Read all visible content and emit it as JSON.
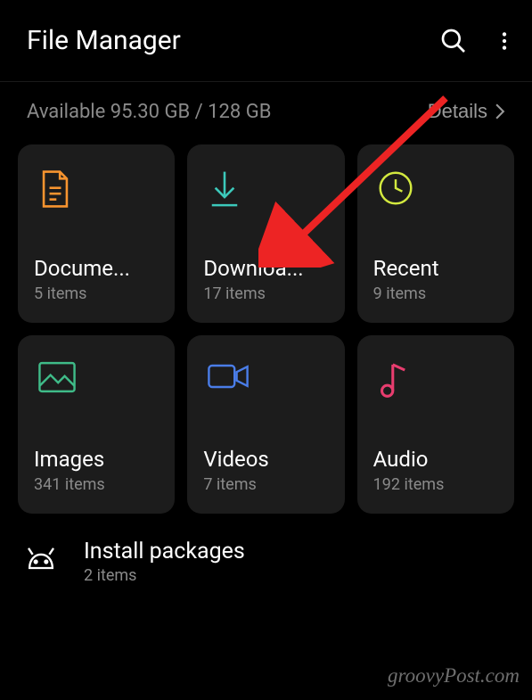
{
  "header": {
    "title": "File Manager"
  },
  "storage": {
    "text": "Available 95.30 GB / 128 GB",
    "details_label": "Details"
  },
  "tiles": [
    {
      "title": "Docume...",
      "sub": "5 items",
      "icon": "document",
      "color": "#f7942f"
    },
    {
      "title": "Downloa...",
      "sub": "17 items",
      "icon": "download",
      "color": "#3cc9bb"
    },
    {
      "title": "Recent",
      "sub": "9 items",
      "icon": "clock",
      "color": "#d3e93f"
    },
    {
      "title": "Images",
      "sub": "341 items",
      "icon": "image",
      "color": "#3fbb88"
    },
    {
      "title": "Videos",
      "sub": "7 items",
      "icon": "video",
      "color": "#4a7de8"
    },
    {
      "title": "Audio",
      "sub": "192 items",
      "icon": "music",
      "color": "#e83d6f"
    }
  ],
  "list": {
    "install_packages": {
      "title": "Install packages",
      "sub": "2 items"
    }
  },
  "watermark": "groovyPost.com"
}
